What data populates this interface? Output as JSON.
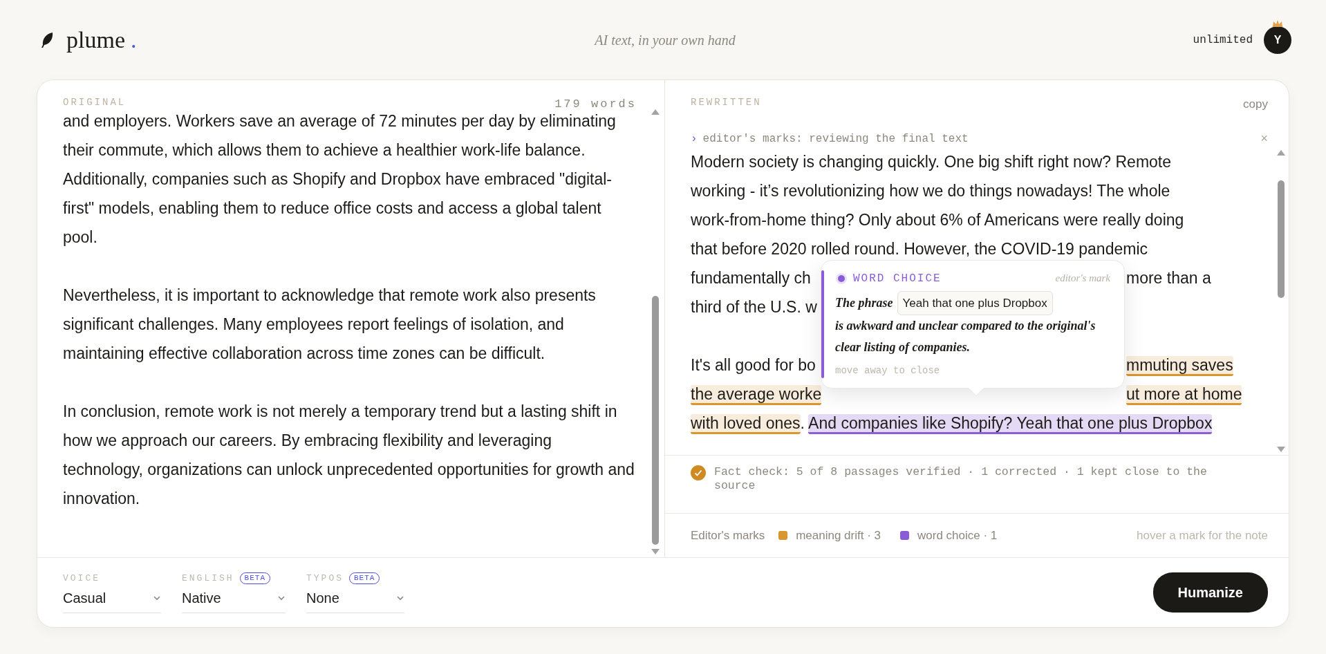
{
  "header": {
    "logo": "plume",
    "logo_dot": ".",
    "tagline": "AI text, in your own hand",
    "plan": "unlimited",
    "avatar": "Y"
  },
  "original": {
    "label": "ORIGINAL",
    "word_count": "179 words",
    "paragraphs": [
      "and employers. Workers save an average of 72 minutes per day by eliminating their commute, which allows them to achieve a healthier work-life balance. Additionally, companies such as Shopify and Dropbox have embraced \"digital-first\" models, enabling them to reduce office costs and access a global talent pool.",
      "Nevertheless, it is important to acknowledge that remote work also presents significant challenges. Many employees report feelings of isolation, and maintaining effective collaboration across time zones can be difficult.",
      "In conclusion, remote work is not merely a temporary trend but a lasting shift in how we approach our careers. By embracing flexibility and leveraging technology, organizations can unlock unprecedented opportunities for growth and innovation."
    ]
  },
  "rewritten": {
    "label": "REWRITTEN",
    "copy": "copy",
    "status": {
      "prompt": "›",
      "text": "editor's marks: reviewing the final text",
      "close": "×"
    },
    "paragraphs": [
      {
        "lines": [
          {
            "left": [
              {
                "text": "Modern society is changing quickly. One big shift right now? Remote",
                "kind": "plain"
              }
            ]
          },
          {
            "left": [
              {
                "text": "working - it’s revolutionizing how we do things nowadays! The whole",
                "kind": "plain"
              }
            ]
          },
          {
            "left": [
              {
                "text": "work-from-home thing? Only about 6% of Americans were really doing",
                "kind": "plain"
              }
            ]
          },
          {
            "left": [
              {
                "text": "that before 2020 rolled round. However, the COVID-19 pandemic",
                "kind": "plain"
              }
            ]
          },
          {
            "left": [
              {
                "text": "fundamentally ch",
                "kind": "plain"
              }
            ],
            "right": [
              {
                "text": "more than a",
                "kind": "plain"
              }
            ]
          },
          {
            "left": [
              {
                "text": "third of the U.S. w",
                "kind": "plain"
              }
            ]
          }
        ]
      },
      {
        "lines": [
          {
            "left": [
              {
                "text": "It's all good for bo",
                "kind": "plain"
              }
            ],
            "right": [
              {
                "text": "mmuting saves",
                "kind": "drift"
              }
            ]
          },
          {
            "left": [
              {
                "text": "the average worke",
                "kind": "drift"
              }
            ],
            "right": [
              {
                "text": "ut more at home",
                "kind": "drift"
              }
            ]
          },
          {
            "left": [
              {
                "text": "with loved ones",
                "kind": "drift"
              },
              {
                "text": ". ",
                "kind": "plain"
              },
              {
                "text": "And companies like Shopify? Yeah that one plus Dropbox",
                "kind": "choice"
              }
            ]
          }
        ]
      }
    ],
    "tooltip": {
      "kind": "choice",
      "title": "WORD CHOICE",
      "source": "editor's mark",
      "lead": "The phrase",
      "phrase": "Yeah that one plus Dropbox",
      "body": "is awkward and unclear compared to the original's clear listing of companies.",
      "hint": "move away to close"
    },
    "fact_check": "Fact check: 5 of 8 passages verified · 1 corrected · 1 kept close to the source",
    "legend": {
      "label": "Editor's marks",
      "items": [
        {
          "label": "meaning drift · 3",
          "color": "#d9952e"
        },
        {
          "label": "word choice · 1",
          "color": "#8a5cd6"
        }
      ],
      "hint": "hover a mark for the note"
    }
  },
  "controls": {
    "selects": [
      {
        "label": "VOICE",
        "value": "Casual"
      },
      {
        "label": "ENGLISH",
        "badge": "BETA",
        "value": "Native"
      },
      {
        "label": "TYPOS",
        "badge": "BETA",
        "value": "None"
      }
    ],
    "button": "Humanize"
  }
}
